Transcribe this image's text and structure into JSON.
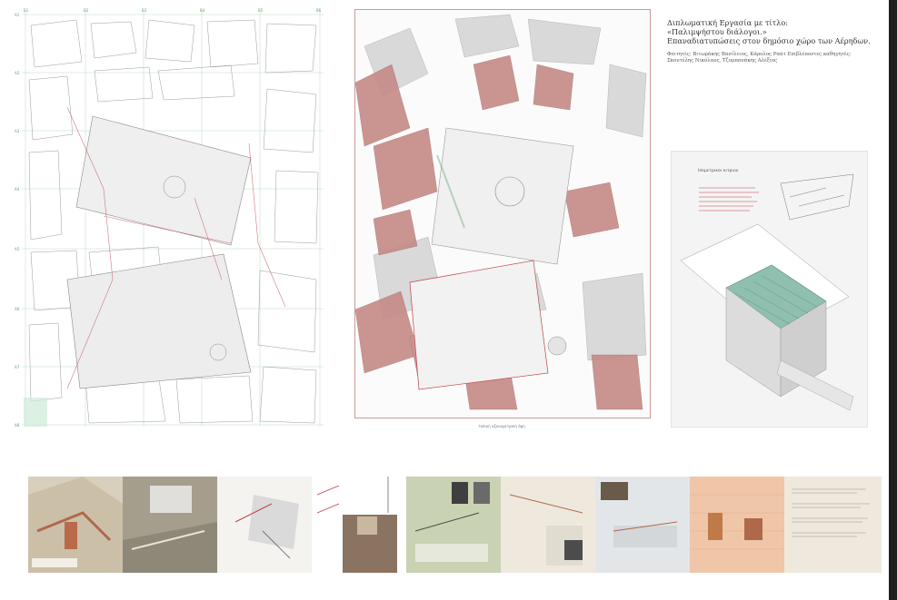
{
  "title": {
    "line1": "Διπλωματική Εργασία με τίτλο:",
    "line2": "«Παλιμψήστου διάλογοι.»",
    "line3": "Επαναδιατυπώσεις στον δημόσιο χώρο των Αέρηδων."
  },
  "credits": {
    "line1": "Φοιτητές: Βιτωράκης Βασίλειος, Κάρολος Ραάτ Επιβλέποντες καθηγητές:",
    "line2": "Σκουτέλης Νικόλαος, Τζομπανάκης Αλέξιος"
  },
  "mid_caption": "τοπική αξονομετρική όψη",
  "axo_title": "Ισομετρικοι κιτριου",
  "grid_labels": {
    "top": [
      "Β1",
      "Β2",
      "Β3",
      "Β4",
      "Β5",
      "Β6"
    ],
    "left": [
      "Α1",
      "Α2",
      "Α3",
      "Α4",
      "Α5",
      "Α6",
      "Α7",
      "Α8"
    ]
  },
  "colors": {
    "accent_red": "#c0404a",
    "building_red": "#c58a86",
    "grid_green": "#58a36e",
    "roof_green": "#8fbfae",
    "board_cream": "#efe9dd",
    "board_sage": "#c9d2b2",
    "board_salmon": "#efc6a8"
  },
  "boards": [
    {
      "theme": "map-aerial"
    },
    {
      "theme": "aerial-photo"
    },
    {
      "theme": "site-plan"
    },
    {
      "theme": "photos-sketch"
    },
    {
      "theme": "green-studies"
    },
    {
      "theme": "beige-studies"
    },
    {
      "theme": "grey-studies"
    },
    {
      "theme": "salmon-elevations"
    },
    {
      "theme": "text-notes"
    }
  ]
}
